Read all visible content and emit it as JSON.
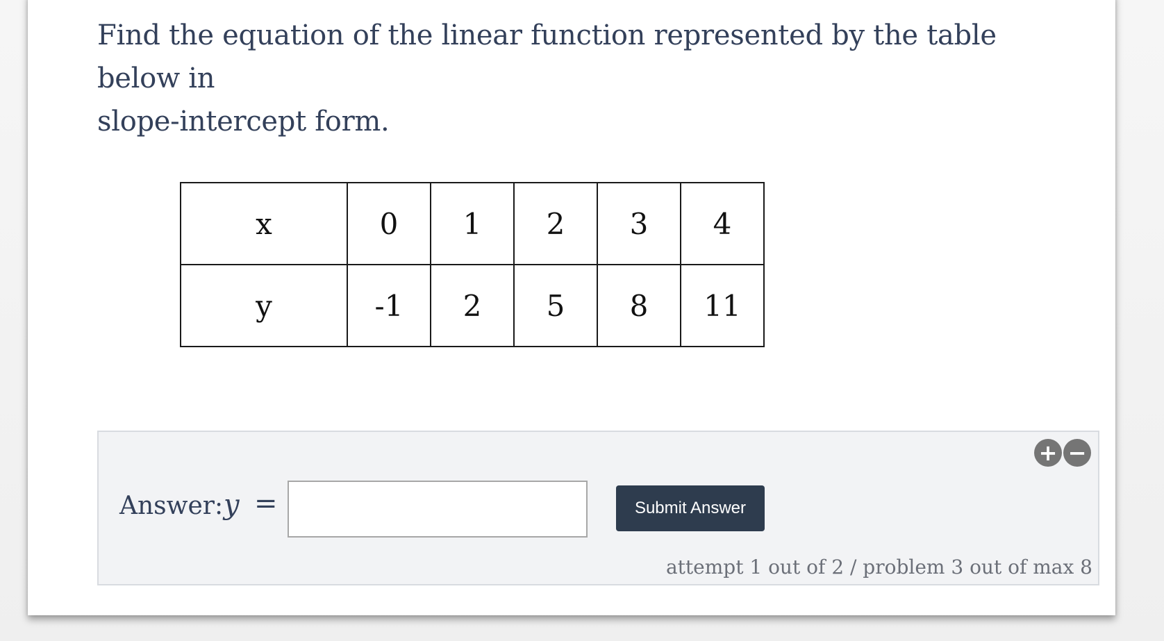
{
  "question": {
    "line1": "Find the equation of the linear function represented by the table below in",
    "line2": "slope-intercept form."
  },
  "table": {
    "rows": [
      {
        "label": "x",
        "values": [
          "0",
          "1",
          "2",
          "3",
          "4"
        ]
      },
      {
        "label": "y",
        "values": [
          "-1",
          "2",
          "5",
          "8",
          "11"
        ]
      }
    ]
  },
  "answer": {
    "label": "Answer:",
    "variable": "y",
    "equals": "=",
    "input_value": "",
    "input_placeholder": ""
  },
  "zoom": {
    "in_icon": "plus-circle-icon",
    "in_glyph": "+",
    "out_icon": "minus-circle-icon",
    "out_glyph": "−"
  },
  "submit": {
    "label": "Submit Answer"
  },
  "status": {
    "attempt_text": "attempt 1 out of 2 / problem 3 out of max 8"
  },
  "colors": {
    "text": "#33405a",
    "button": "#2e3c4e",
    "answer_panel": "#f2f3f5"
  }
}
